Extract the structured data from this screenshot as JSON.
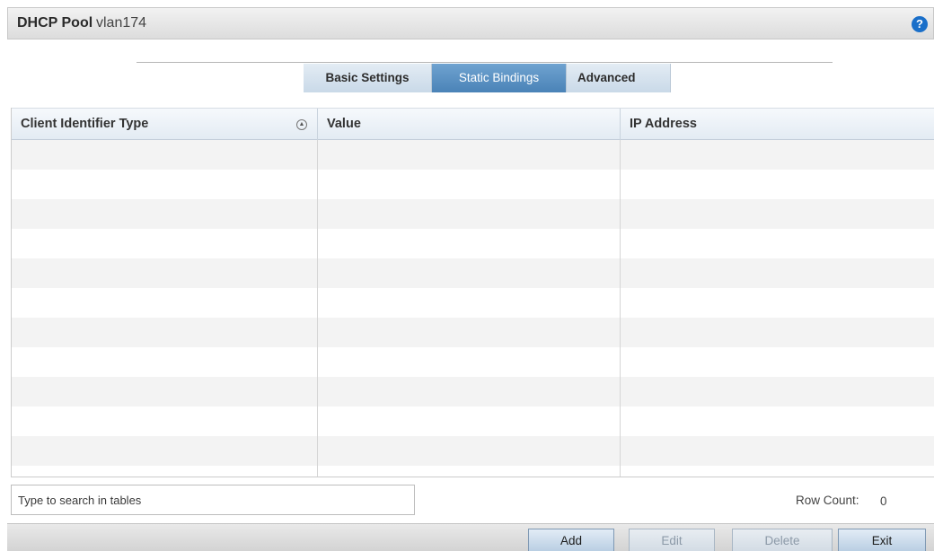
{
  "header": {
    "title": "DHCP Pool",
    "subtitle": "vlan174",
    "help_icon": "question-circle-icon",
    "help_glyph": "?"
  },
  "tabs": [
    {
      "label": "Basic Settings",
      "active": false
    },
    {
      "label": "Static Bindings",
      "active": true
    },
    {
      "label": "Advanced",
      "active": false
    }
  ],
  "table": {
    "columns": [
      "Client Identifier Type",
      "Value",
      "IP Address"
    ],
    "sort_icon": "sort-ascending-icon",
    "sort_glyph": "▲",
    "rows": []
  },
  "search": {
    "placeholder": "Type to search in tables",
    "value": ""
  },
  "row_count": {
    "label": "Row Count:",
    "value": "0"
  },
  "footer": {
    "add_label": "Add",
    "edit_label": "Edit",
    "delete_label": "Delete",
    "exit_label": "Exit"
  },
  "colors": {
    "active_tab": "#5a92c4",
    "help_icon": "#1a6fc9"
  }
}
